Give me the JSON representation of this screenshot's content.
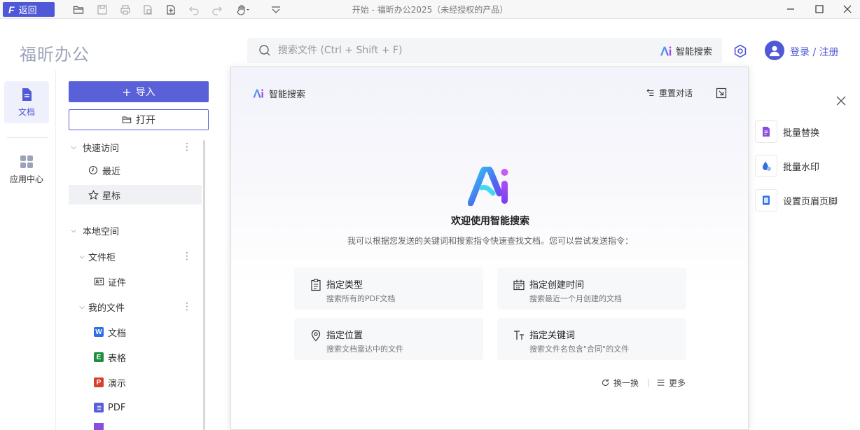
{
  "titlebar": {
    "back_label": "返回",
    "title": "开始 - 福昕办公2025（未经授权的产品）"
  },
  "header": {
    "app_title": "福昕办公",
    "search_placeholder": "搜索文件 (Ctrl + Shift + F)",
    "smart_search_label": "智能搜索",
    "login_label": "登录 / 注册"
  },
  "rail": {
    "items": [
      {
        "label": "文档",
        "active": true
      },
      {
        "label": "应用中心",
        "active": false
      }
    ]
  },
  "sidebar": {
    "import_label": "导入",
    "open_label": "打开",
    "quick_access": "快速访问",
    "recent": "最近",
    "starred": "星标",
    "local_space": "本地空间",
    "cabinet": "文件柜",
    "certificate": "证件",
    "my_files": "我的文件",
    "doc": "文档",
    "sheet": "表格",
    "slides": "演示",
    "pdf": "PDF",
    "badge_doc": "W",
    "badge_sheet": "E",
    "badge_slides": "P"
  },
  "popup": {
    "title": "智能搜索",
    "reset_label": "重置对话",
    "welcome": "欢迎使用智能搜索",
    "intro": "我可以根据您发送的关键词和搜索指令快速查找文档。您可以尝试发送指令：",
    "cards": [
      {
        "title": "指定类型",
        "desc": "搜索所有的PDF文档",
        "icon": "document-list-icon"
      },
      {
        "title": "指定创建时间",
        "desc": "搜索最近一个月创建的文档",
        "icon": "calendar-icon"
      },
      {
        "title": "指定位置",
        "desc": "搜索文档雷达中的文件",
        "icon": "location-pin-icon"
      },
      {
        "title": "指定关键词",
        "desc": "搜索文件名包含\"合同\"的文件",
        "icon": "text-type-icon"
      }
    ],
    "refresh_label": "换一换",
    "more_label": "更多"
  },
  "tools": [
    {
      "label": "批量替换",
      "icon": "batch-replace-icon"
    },
    {
      "label": "批量水印",
      "icon": "batch-watermark-icon"
    },
    {
      "label": "设置页眉页脚",
      "icon": "header-footer-icon"
    }
  ],
  "colors": {
    "accent": "#4f58d6",
    "excel_green": "#1e8e3e",
    "ppt_red": "#d93f2e",
    "pdf_purple": "#5b5fd9"
  }
}
